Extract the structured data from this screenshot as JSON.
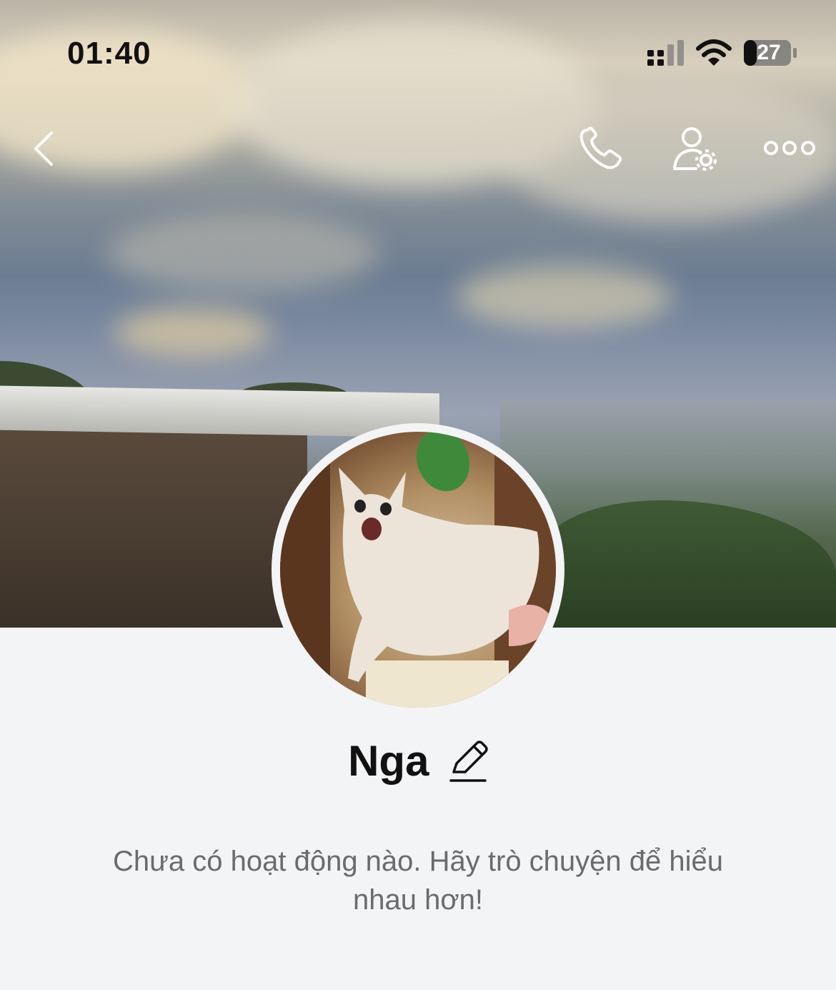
{
  "status_bar": {
    "time": "01:40",
    "battery_level": "27"
  },
  "header": {
    "icons": [
      "back-arrow-icon",
      "phone-icon",
      "user-settings-icon",
      "more-icon"
    ]
  },
  "profile": {
    "name": "Nga",
    "edit_icon": "pencil-icon"
  },
  "feed": {
    "empty_message": "Chưa có hoạt động nào. Hãy trò chuyện để hiểu nhau hơn!"
  },
  "colors": {
    "background": "#f3f4f6",
    "text_primary": "#111111",
    "text_secondary": "#6b6b6b",
    "icon_on_cover": "#ffffff"
  }
}
